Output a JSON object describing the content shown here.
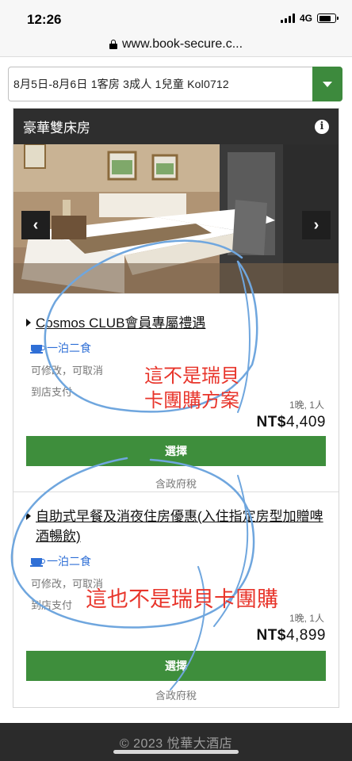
{
  "status_bar": {
    "time": "12:26",
    "network": "4G",
    "battery_level": 0.75
  },
  "browser": {
    "url": "www.book-secure.c..."
  },
  "search": {
    "summary": "8月5日-8月6日  1客房 3成人 1兒童  Kol0712"
  },
  "room": {
    "name": "豪華雙床房",
    "info_icon": "info-icon",
    "prev_icon": "chevron-left-icon",
    "next_icon": "chevron-right-icon"
  },
  "plans": [
    {
      "title": "Cosmos CLUB會員專屬禮遇",
      "meal": "一泊二食",
      "policy": "可修改，可取消",
      "payment": "到店支付",
      "nights": "1晚, 1人",
      "price_currency": "NT$",
      "price_amount": "4,409",
      "select_label": "選擇",
      "tax_note": "含政府稅"
    },
    {
      "title": "自助式早餐及消夜住房優惠(入住指定房型加贈啤酒暢飲)",
      "meal": "一泊二食",
      "policy": "可修改，可取消",
      "payment": "到店支付",
      "nights": "1晚, 1人",
      "price_currency": "NT$",
      "price_amount": "4,899",
      "select_label": "選擇",
      "tax_note": "含政府稅"
    }
  ],
  "annotations": {
    "note1_line1": "這不是瑞貝",
    "note1_line2": "卡團購方案",
    "note2": "這也不是瑞貝卡團購"
  },
  "footer": {
    "copyright": "© 2023 悅華大酒店"
  },
  "colors": {
    "accent_green": "#3e8e3c",
    "header_dark": "#2e2e2e",
    "meal_blue": "#2f6fd6",
    "annotation_red": "#e8352b",
    "scribble_blue": "#6fa6de"
  }
}
